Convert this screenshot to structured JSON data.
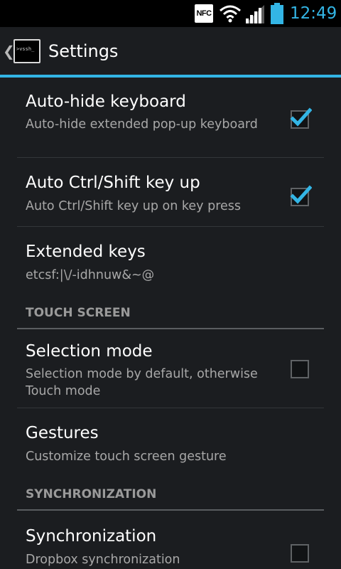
{
  "status_bar": {
    "nfc_label": "NFC",
    "wifi_icon": "wifi-icon",
    "signal_icon": "cell-signal-icon",
    "battery_icon": "battery-icon",
    "time": "12:49",
    "accent_color": "#33b5e5"
  },
  "action_bar": {
    "up_icon": "chevron-left-icon",
    "app_icon_text": ">vssh_",
    "title": "Settings",
    "divider_color": "#33b5e5"
  },
  "preferences": {
    "auto_hide_keyboard": {
      "title": "Auto-hide keyboard",
      "summary": "Auto-hide extended pop-up keyboard",
      "checked": true
    },
    "auto_ctrl_shift": {
      "title": "Auto Ctrl/Shift key up",
      "summary": "Auto Ctrl/Shift key up on key press",
      "checked": true
    },
    "extended_keys": {
      "title": "Extended keys",
      "summary": "etcsf:|\\/-idhnuw&~@"
    },
    "touch_screen_header": "TOUCH SCREEN",
    "selection_mode": {
      "title": "Selection mode",
      "summary": "Selection mode by default, otherwise Touch mode",
      "checked": false
    },
    "gestures": {
      "title": "Gestures",
      "summary": "Customize touch screen gesture"
    },
    "synchronization_header": "SYNCHRONIZATION",
    "synchronization": {
      "title": "Synchronization",
      "summary": "Dropbox synchronization",
      "checked": false
    }
  }
}
